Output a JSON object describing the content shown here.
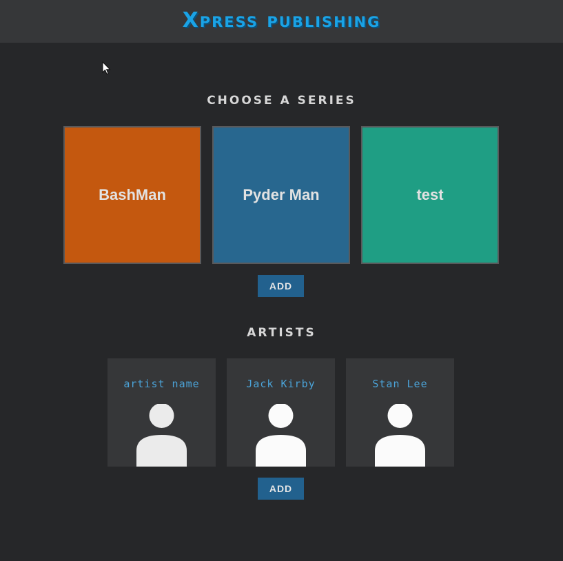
{
  "header": {
    "logo_text": "Xpress publishing",
    "logo_color": "#1aa3e6"
  },
  "series_section": {
    "title": "CHOOSE A SERIES",
    "items": [
      {
        "name": "BashMan",
        "color": "#c4580f"
      },
      {
        "name": "Pyder Man",
        "color": "#28678f"
      },
      {
        "name": "test",
        "color": "#1f9e84"
      }
    ],
    "add_label": "ADD"
  },
  "artists_section": {
    "title": "ARTISTS",
    "items": [
      {
        "name": "artist name",
        "avatar_icon": "person-icon"
      },
      {
        "name": "Jack Kirby",
        "avatar_icon": "person-icon"
      },
      {
        "name": "Stan Lee",
        "avatar_icon": "person-icon"
      }
    ],
    "add_label": "ADD"
  },
  "colors": {
    "background": "#262729",
    "topbar": "#363739",
    "button": "#22618e",
    "artist_name": "#4ba3d8"
  }
}
